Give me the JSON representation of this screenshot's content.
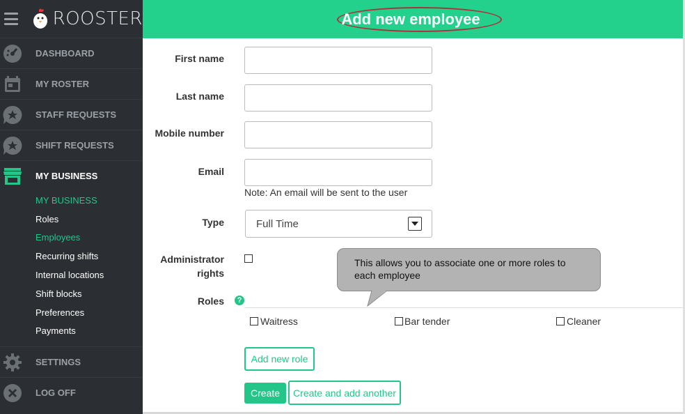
{
  "brand": {
    "name": "ROOSTER"
  },
  "sidebar": {
    "items": [
      {
        "label": "DASHBOARD",
        "icon": "dashboard-gauge-icon"
      },
      {
        "label": "MY ROSTER",
        "icon": "calendar-icon"
      },
      {
        "label": "STAFF REQUESTS",
        "icon": "star-chat-icon"
      },
      {
        "label": "SHIFT REQUESTS",
        "icon": "star-chat-icon"
      },
      {
        "label": "MY BUSINESS",
        "icon": "storefront-icon"
      }
    ],
    "subitems": [
      {
        "label": "MY BUSINESS"
      },
      {
        "label": "Roles"
      },
      {
        "label": "Employees"
      },
      {
        "label": "Recurring shifts"
      },
      {
        "label": "Internal locations"
      },
      {
        "label": "Shift blocks"
      },
      {
        "label": "Preferences"
      },
      {
        "label": "Payments"
      }
    ],
    "bottom_items": [
      {
        "label": "SETTINGS",
        "icon": "gear-icon"
      },
      {
        "label": "LOG OFF",
        "icon": "close-circle-icon"
      }
    ],
    "accent_color": "#23c589"
  },
  "header": {
    "title": "Add new employee",
    "color": "#23d08c"
  },
  "form": {
    "first_name_label": "First name",
    "last_name_label": "Last name",
    "mobile_label": "Mobile number",
    "email_label": "Email",
    "email_note": "Note: An email will be sent to the user",
    "type_label": "Type",
    "type_value": "Full Time",
    "admin_label_1": "Administrator",
    "admin_label_2": "rights",
    "roles_label": "Roles",
    "roles": [
      "Waitress",
      "Bar tender",
      "Cleaner"
    ],
    "add_role_button": "Add new role",
    "create_button": "Create",
    "create_another_button": "Create and add another"
  },
  "tooltip": {
    "text": "This allows you to associate one or more  roles to each employee"
  }
}
